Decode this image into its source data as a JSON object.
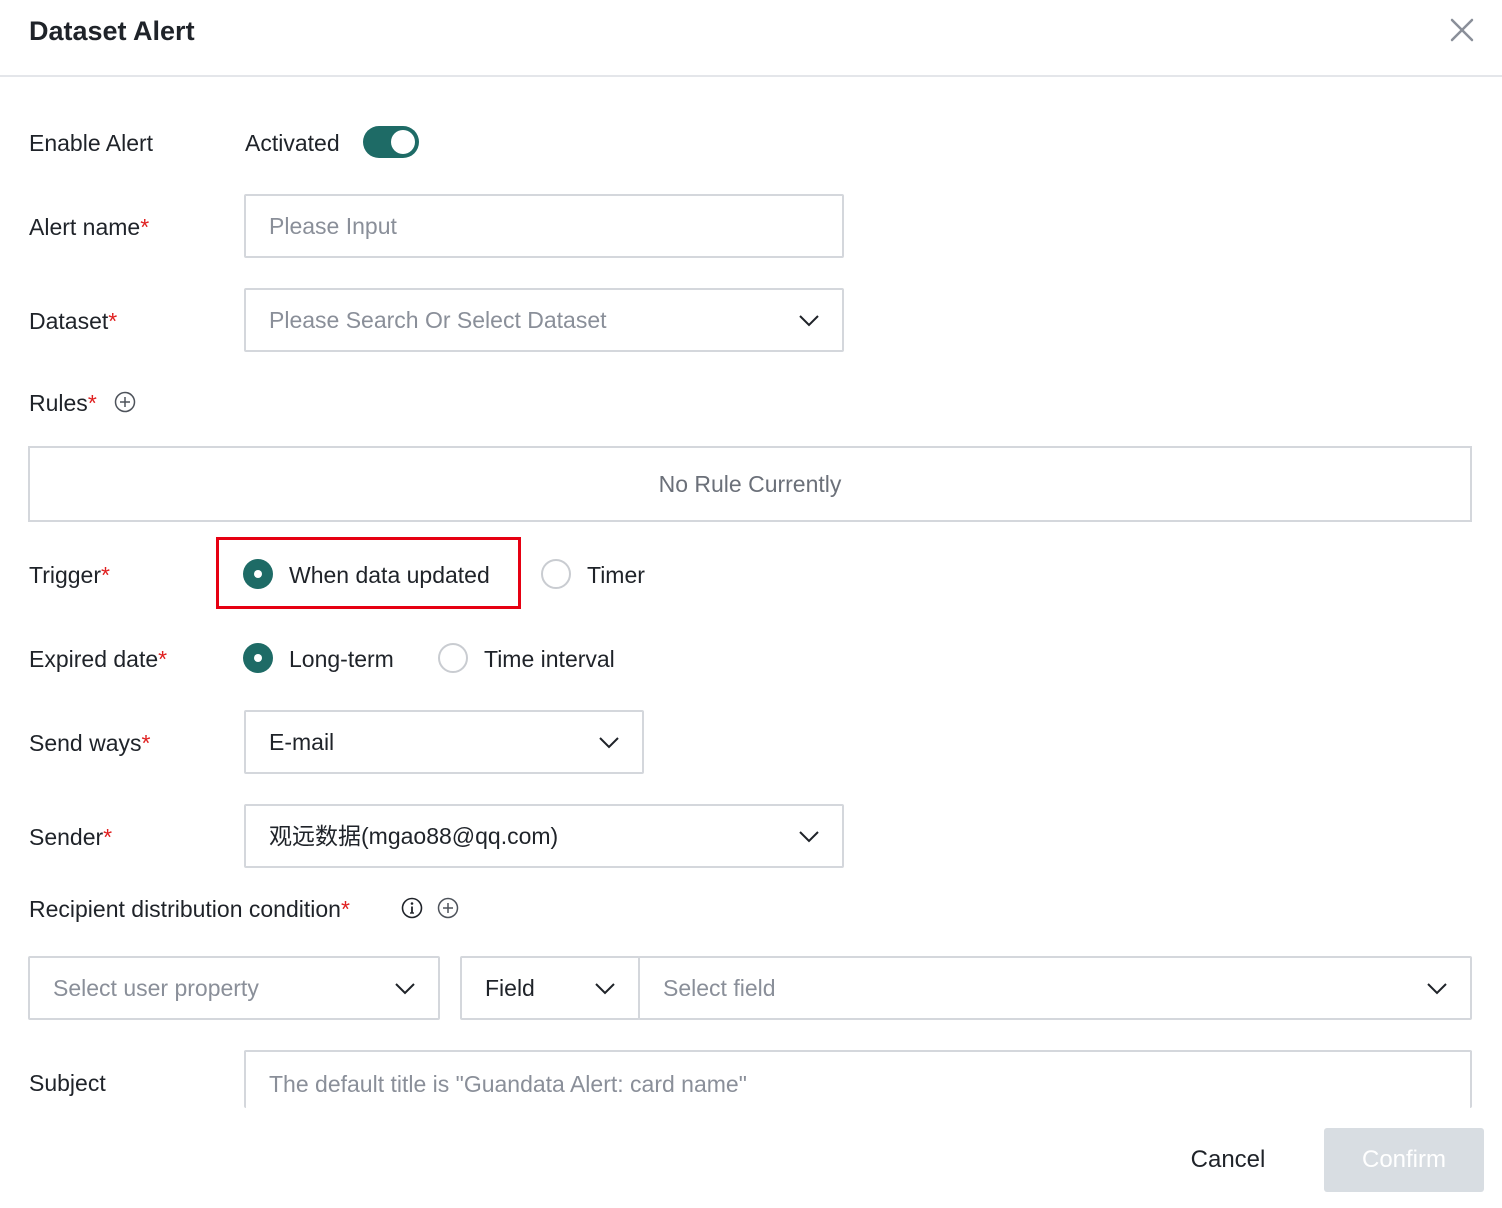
{
  "dialog": {
    "title": "Dataset Alert",
    "close_icon": "close-icon"
  },
  "enable_alert": {
    "label": "Enable Alert",
    "status": "Activated",
    "on": true
  },
  "alert_name": {
    "label": "Alert name",
    "required": "*",
    "placeholder": "Please Input",
    "value": ""
  },
  "dataset": {
    "label": "Dataset",
    "required": "*",
    "placeholder": "Please Search Or Select Dataset"
  },
  "rules": {
    "label": "Rules",
    "required": "*",
    "add_icon": "plus-circle-icon",
    "empty_text": "No Rule Currently"
  },
  "trigger": {
    "label": "Trigger",
    "required": "*",
    "options": [
      "When data updated",
      "Timer"
    ],
    "selected": "When data updated"
  },
  "expired_date": {
    "label": "Expired date",
    "required": "*",
    "options": [
      "Long-term",
      "Time interval"
    ],
    "selected": "Long-term"
  },
  "send_ways": {
    "label": "Send ways",
    "required": "*",
    "value": "E-mail"
  },
  "sender": {
    "label": "Sender",
    "required": "*",
    "value": "观远数据(mgao88@qq.com)"
  },
  "recipient": {
    "label": "Recipient distribution condition",
    "required": "*",
    "info_icon": "info-icon",
    "add_icon": "plus-circle-icon",
    "property_placeholder": "Select user property",
    "type_value": "Field",
    "field_placeholder": "Select field"
  },
  "subject": {
    "label": "Subject",
    "placeholder": "The default title is \"Guandata Alert:  card name\""
  },
  "footer": {
    "cancel_label": "Cancel",
    "confirm_label": "Confirm"
  },
  "colors": {
    "accent": "#1e6b66",
    "required": "#e02020",
    "highlight": "#e60012",
    "confirm_disabled": "#d8dde2"
  }
}
